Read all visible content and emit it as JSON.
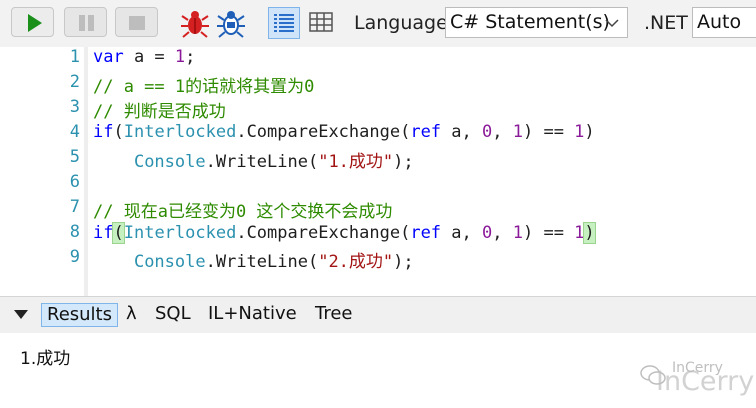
{
  "toolbar": {
    "language_label": "Language",
    "language_value": "C# Statement(s)",
    "framework_label": ".NET",
    "framework_value": "Auto",
    "icons": [
      "play-icon",
      "pause-icon",
      "stop-icon",
      "bug-red-icon",
      "bug-blue-icon",
      "list-view-icon",
      "grid-view-icon",
      "chevron-down-icon"
    ],
    "colors": {
      "run_green": "#1a8f1a",
      "bug_red": "#d42020",
      "bug_blue": "#1f5fb8",
      "active_view": "#cfe4f8"
    }
  },
  "editor": {
    "line_numbers": [
      "1",
      "2",
      "3",
      "4",
      "5",
      "6",
      "7",
      "8",
      "9"
    ],
    "lines": [
      {
        "parts": [
          [
            "kw",
            "var"
          ],
          [
            "",
            " a = "
          ],
          [
            "num",
            "1"
          ],
          [
            "",
            ";"
          ]
        ]
      },
      {
        "parts": [
          [
            "cm",
            "// a == 1的话就将其置为0"
          ]
        ]
      },
      {
        "parts": [
          [
            "cm",
            "// 判断是否成功"
          ]
        ]
      },
      {
        "parts": [
          [
            "kw",
            "if"
          ],
          [
            "",
            "("
          ],
          [
            "ty",
            "Interlocked"
          ],
          [
            "",
            ".CompareExchange("
          ],
          [
            "kw",
            "ref"
          ],
          [
            "",
            " a, "
          ],
          [
            "num",
            "0"
          ],
          [
            "",
            ", "
          ],
          [
            "num",
            "1"
          ],
          [
            "",
            ") == "
          ],
          [
            "num",
            "1"
          ],
          [
            "",
            ")"
          ]
        ]
      },
      {
        "parts": [
          [
            "",
            "    "
          ],
          [
            "ty",
            "Console"
          ],
          [
            "",
            ".WriteLine("
          ],
          [
            "st",
            "\"1.成功\""
          ],
          [
            "",
            ");"
          ]
        ]
      },
      {
        "parts": [
          [
            "",
            ""
          ]
        ]
      },
      {
        "parts": [
          [
            "cm",
            "// 现在a已经变为0 这个交换不会成功"
          ]
        ]
      },
      {
        "parts": [
          [
            "kw",
            "if"
          ],
          [
            "hl",
            "("
          ],
          [
            "ty",
            "Interlocked"
          ],
          [
            "",
            ".CompareExchange("
          ],
          [
            "kw",
            "ref"
          ],
          [
            "",
            " a, "
          ],
          [
            "num",
            "0"
          ],
          [
            "",
            ", "
          ],
          [
            "num",
            "1"
          ],
          [
            "",
            ") == "
          ],
          [
            "num",
            "1"
          ],
          [
            "hl",
            ")"
          ],
          [
            "caret",
            ""
          ]
        ]
      },
      {
        "parts": [
          [
            "",
            "    "
          ],
          [
            "ty",
            "Console"
          ],
          [
            "",
            ".WriteLine("
          ],
          [
            "st",
            "\"2.成功\""
          ],
          [
            "",
            ");"
          ]
        ]
      }
    ]
  },
  "results": {
    "tabs": [
      "Results",
      "λ",
      "SQL",
      "IL+Native",
      "Tree"
    ],
    "active_tab": "Results",
    "output": "1.成功"
  },
  "watermark": {
    "line1": "InCerry",
    "line2": "InCerry"
  }
}
